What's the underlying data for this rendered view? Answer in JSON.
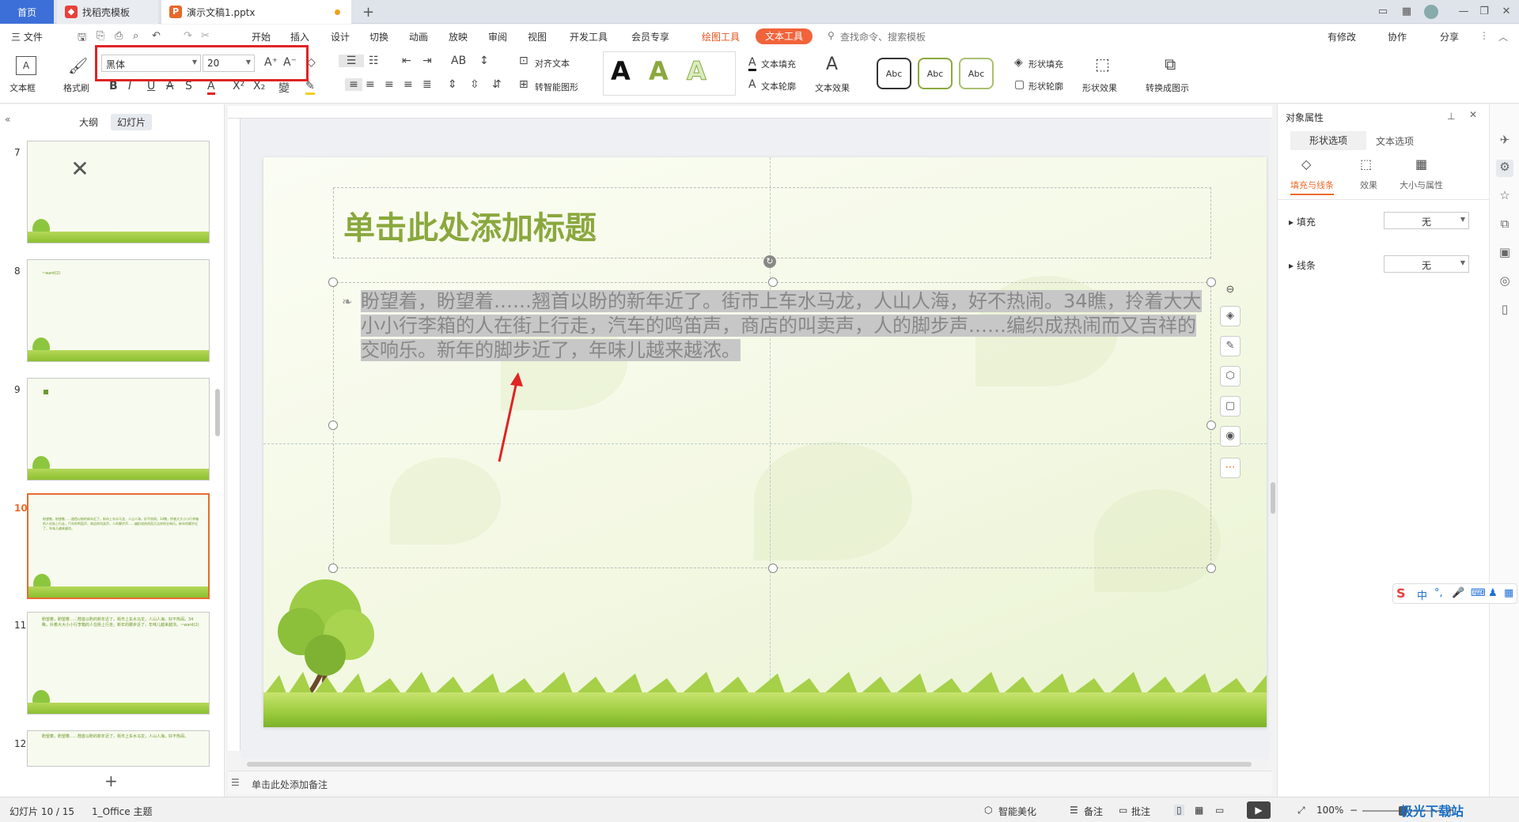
{
  "tabs": {
    "home": "首页",
    "template": "找稻壳模板",
    "document": "演示文稿1.pptx"
  },
  "menu": {
    "file": "三 文件",
    "items": [
      "开始",
      "插入",
      "设计",
      "切换",
      "动画",
      "放映",
      "审阅",
      "视图",
      "开发工具",
      "会员专享"
    ],
    "drawing_tools": "绘图工具",
    "text_tools": "文本工具",
    "search": "查找命令、搜索模板",
    "modified": "有修改",
    "collab": "协作",
    "share": "分享"
  },
  "ribbon": {
    "textbox": "文本框",
    "format_painter": "格式刷",
    "font_name": "黑体",
    "font_size": "20",
    "align_text": "对齐文本",
    "smart_graphic": "转智能图形",
    "text_fill": "文本填充",
    "text_outline": "文本轮廓",
    "text_effect": "文本效果",
    "style_sample": "Abc",
    "shape_fill": "形状填充",
    "shape_outline": "形状轮廓",
    "shape_effect": "形状效果",
    "convert_image": "转换成图示"
  },
  "left_panel": {
    "outline_tab": "大纲",
    "slides_tab": "幻灯片",
    "slide_numbers": [
      "7",
      "8",
      "9",
      "10",
      "11",
      "12"
    ],
    "thumb8_text": "~ward(2)",
    "thumb10_text": "盼望着，盼望着……翘首以盼的新年近了。街市上车水马龙，人山人海，好不热闹。34瞧，拎着大大小小行李箱的人在街上行走，汽车的鸣笛声，商店的叫卖声，人的脚步声……编织成热闹而又吉祥的交响乐。新年的脚步近了，年味儿越来越浓。",
    "thumb11_text": "盼望着，盼望着……翘首以盼的新年近了。街市上车水马龙，人山人海，好不热闹。34瞧，拎着大大小小行李箱的人在街上行走。新年的脚步近了，年味儿越来越浓。~ward(2)",
    "thumb12_text": "盼望着，盼望着……翘首以盼的新年近了。街市上车水马龙，人山人海，好不热闹。"
  },
  "slide": {
    "title_placeholder": "单击此处添加标题",
    "body_text": "盼望着，盼望着……翘首以盼的新年近了。街市上车水马龙，人山人海，好不热闹。34瞧，拎着大大小小行李箱的人在街上行走，汽车的鸣笛声，商店的叫卖声，人的脚步声……编织成热闹而又吉祥的交响乐。新年的脚步近了，年味儿越来越浓。"
  },
  "notes": {
    "placeholder": "单击此处添加备注"
  },
  "right_panel": {
    "title": "对象属性",
    "tab_shape": "形状选项",
    "tab_text": "文本选项",
    "sub_fill_line": "填充与线条",
    "sub_effect": "效果",
    "sub_size": "大小与属性",
    "fill_label": "填充",
    "fill_value": "无",
    "line_label": "线条",
    "line_value": "无"
  },
  "status": {
    "slide_info": "幻灯片 10 / 15",
    "theme": "1_Office 主题",
    "beautify": "智能美化",
    "notes": "备注",
    "comments": "批注",
    "zoom": "100%"
  },
  "ime": {
    "mode": "中"
  },
  "watermark": "极光下载站",
  "colors": {
    "accent_red": "#e02424",
    "title_green": "#8aa83d",
    "tab_blue": "#3d6fd8",
    "orange": "#e86c2c"
  }
}
